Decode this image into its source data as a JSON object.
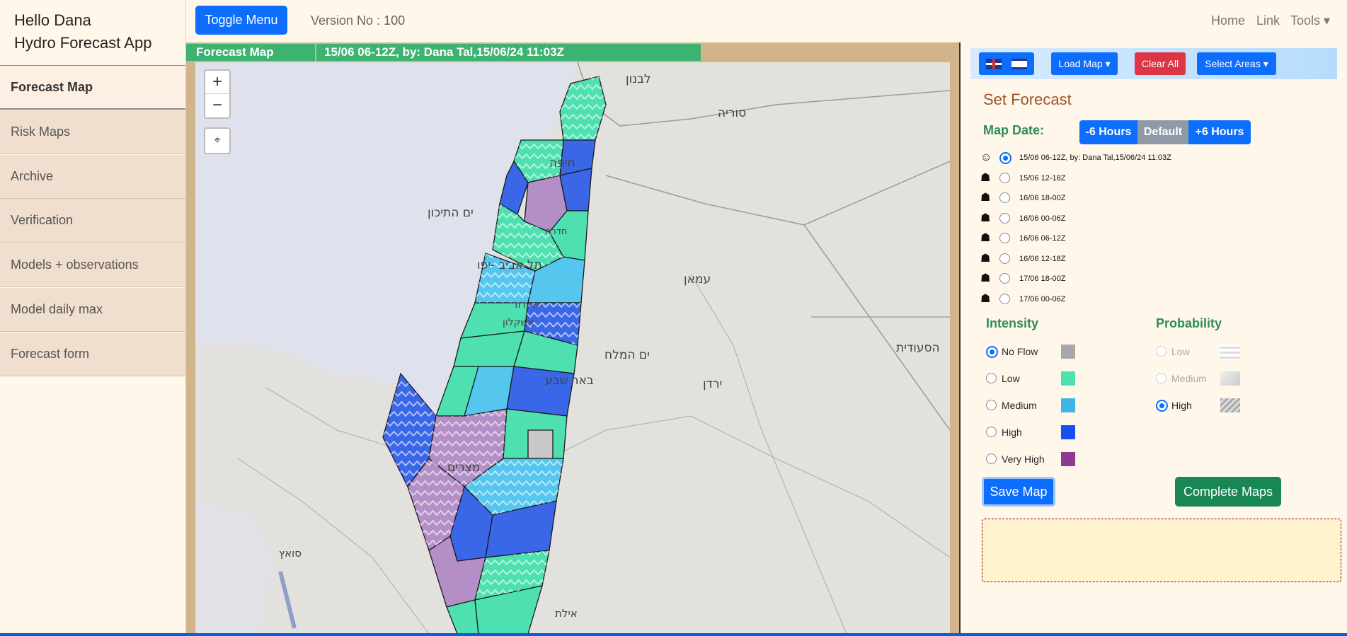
{
  "sidebar": {
    "greeting": "Hello Dana",
    "app_name": "Hydro Forecast App",
    "items": [
      {
        "label": "Forecast Map"
      },
      {
        "label": "Risk Maps"
      },
      {
        "label": "Archive"
      },
      {
        "label": "Verification"
      },
      {
        "label": "Models + observations"
      },
      {
        "label": "Model daily max"
      },
      {
        "label": "Forecast form"
      }
    ]
  },
  "topbar": {
    "toggle_label": "Toggle Menu",
    "version": "Version No : 100",
    "nav": {
      "home": "Home",
      "link": "Link",
      "tools": "Tools ▾"
    }
  },
  "map": {
    "header_title": "Forecast Map",
    "header_info": "15/06 06-12Z, by: Dana Tal,15/06/24 11:03Z",
    "zoom_in": "+",
    "zoom_out": "−",
    "locate": "⌖",
    "labels": {
      "lebanon": "לבנון",
      "syria": "סוריה",
      "haifa": "חיפה",
      "med_sea": "ים התיכון",
      "hadera": "חדרה",
      "tel_aviv": "תל אביב -יפו",
      "amman": "עמאן",
      "ashdod": "אשדוד",
      "ashkelon": "אשקלון",
      "dead_sea": "ים המלח",
      "beer_sheva": "באר שבע",
      "saudi": "הסעודית",
      "jordan": "ירדן",
      "egypt": "מצרים",
      "suez": "סואץ",
      "eilat": "אילת"
    }
  },
  "panel": {
    "load_map": "Load Map ▾",
    "clear_all": "Clear All",
    "select_areas": "Select Areas ▾",
    "set_forecast": "Set Forecast",
    "map_date_label": "Map Date:",
    "minus6": "-6 Hours",
    "default": "Default",
    "plus6": "+6 Hours",
    "dates": [
      {
        "icon": "☺",
        "text": "15/06 06-12Z, by: Dana Tal,15/06/24 11:03Z",
        "selected": true
      },
      {
        "icon": "☗",
        "text": "15/06 12-18Z",
        "selected": false
      },
      {
        "icon": "☗",
        "text": "16/06 18-00Z",
        "selected": false
      },
      {
        "icon": "☗",
        "text": "16/06 00-06Z",
        "selected": false
      },
      {
        "icon": "☗",
        "text": "16/06 06-12Z",
        "selected": false
      },
      {
        "icon": "☗",
        "text": "16/06 12-18Z",
        "selected": false
      },
      {
        "icon": "☗",
        "text": "17/06 18-00Z",
        "selected": false
      },
      {
        "icon": "☗",
        "text": "17/06 00-06Z",
        "selected": false
      }
    ],
    "intensity_title": "Intensity",
    "intensity": [
      {
        "label": "No Flow",
        "color": "#a8a8a8",
        "selected": true
      },
      {
        "label": "Low",
        "color": "#4ee0b0",
        "selected": false
      },
      {
        "label": "Medium",
        "color": "#40b4e6",
        "selected": false
      },
      {
        "label": "High",
        "color": "#1550f0",
        "selected": false
      },
      {
        "label": "Very High",
        "color": "#8e3a8e",
        "selected": false
      }
    ],
    "probability_title": "Probability",
    "probability": [
      {
        "label": "Low",
        "selected": false
      },
      {
        "label": "Medium",
        "selected": false
      },
      {
        "label": "High",
        "selected": true
      }
    ],
    "save_label": "Save Map",
    "complete_label": "Complete Maps"
  }
}
